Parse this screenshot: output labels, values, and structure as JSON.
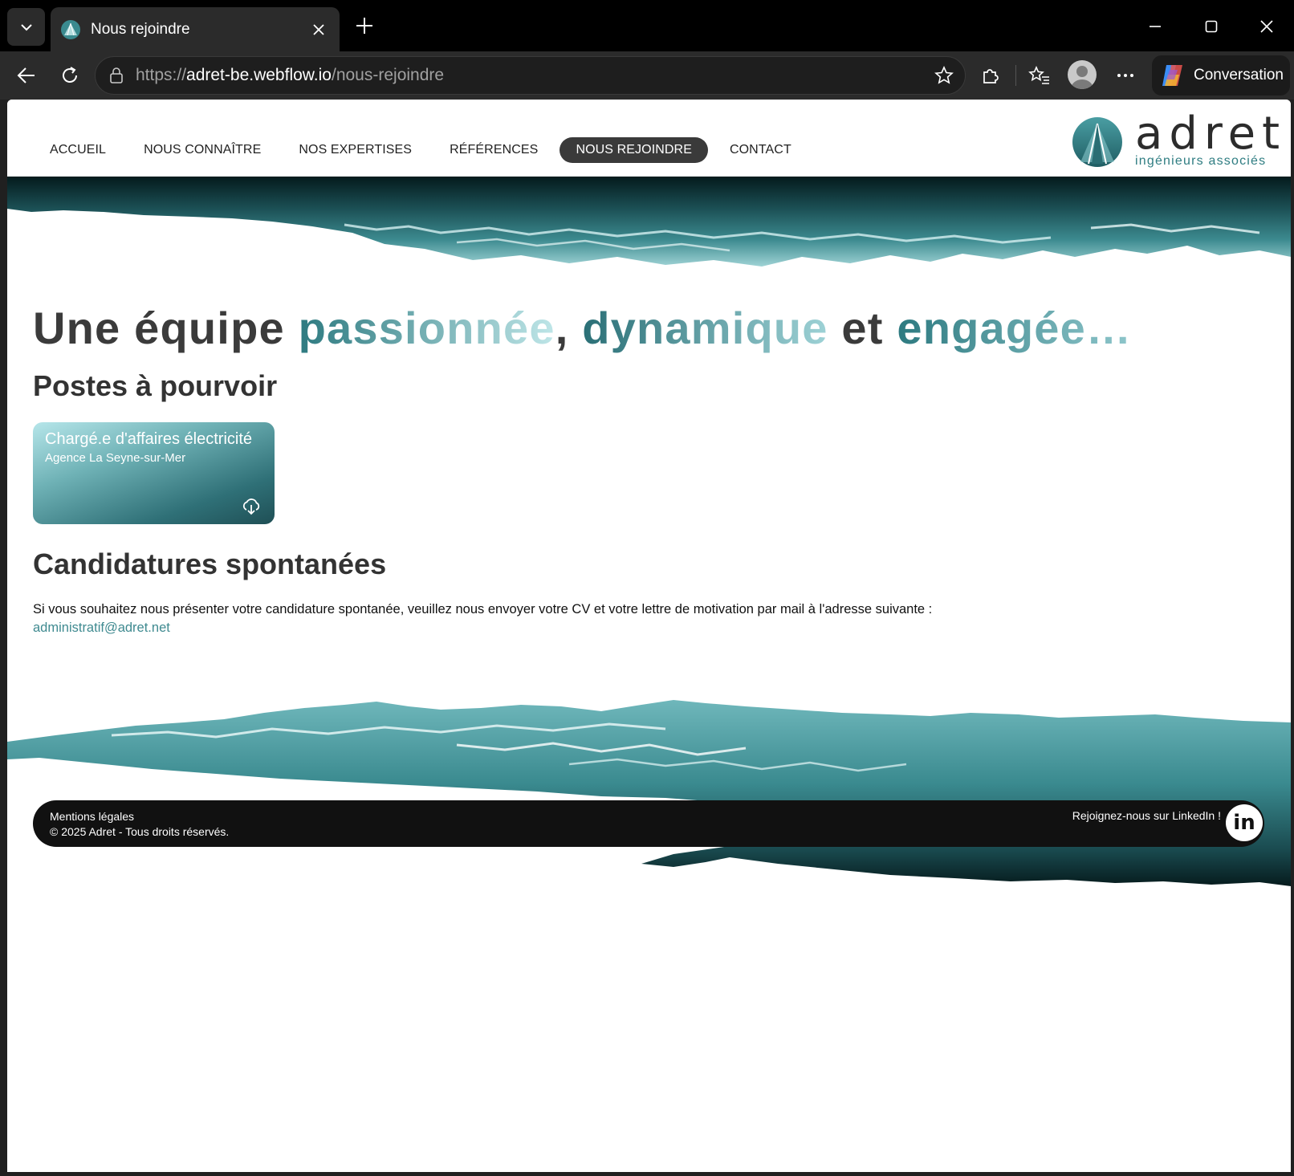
{
  "browser": {
    "tab_title": "Nous rejoindre",
    "url_scheme": "https://",
    "url_host": "adret-be.webflow.io",
    "url_path": "/nous-rejoindre",
    "copilot_label": "Conversation"
  },
  "nav": {
    "items": [
      {
        "label": "ACCUEIL"
      },
      {
        "label": "NOUS CONNAÎTRE"
      },
      {
        "label": "NOS EXPERTISES"
      },
      {
        "label": "RÉFÉRENCES"
      },
      {
        "label": "NOUS REJOINDRE",
        "active": true
      },
      {
        "label": "CONTACT"
      }
    ]
  },
  "logo": {
    "word": "adret",
    "subtitle": "ingénieurs associés"
  },
  "headline": {
    "part1": "Une équipe ",
    "w1": "passionnée",
    "part2": ", ",
    "w2": "dynamique",
    "part3": " et ",
    "w3": "engagée…"
  },
  "jobs": {
    "heading": "Postes à pourvoir",
    "items": [
      {
        "title": "Chargé.e d'affaires électricité",
        "agency": "Agence La Seyne-sur-Mer"
      }
    ]
  },
  "spontaneous": {
    "heading": "Candidatures spontanées",
    "text": "Si vous souhaitez nous présenter votre candidature spontanée, veuillez nous envoyer votre CV et votre lettre de motivation par mail à l'adresse suivante :",
    "email": "administratif@adret.net"
  },
  "footer": {
    "legal": "Mentions légales",
    "copyright": "© 2025 Adret - Tous droits réservés.",
    "linkedin": "Rejoignez-nous sur LinkedIn !",
    "linkedin_icon": "in"
  },
  "colors": {
    "accent": "#2f7d82",
    "footer_bg": "#111111",
    "active_nav": "#3a3a3a"
  }
}
